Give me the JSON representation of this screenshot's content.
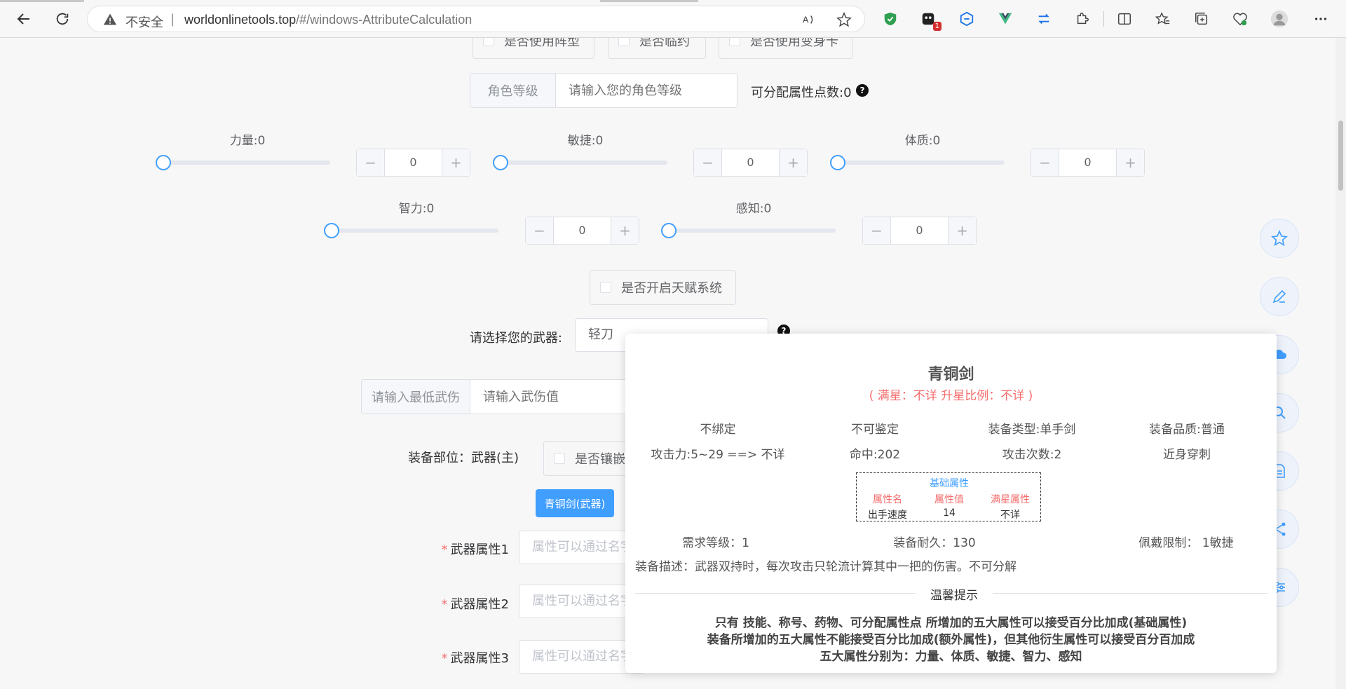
{
  "browser": {
    "insecure_label": "不安全",
    "url_host": "worldonlinetools.top",
    "url_path": "/#/windows-AttributeCalculation",
    "ext_badge": "1"
  },
  "options_top": {
    "formation": "是否使用阵型",
    "contract": "是否临约",
    "transform_card": "是否使用变身卡"
  },
  "level": {
    "label": "角色等级",
    "placeholder": "请输入您的角色等级",
    "points_text": "可分配属性点数:0"
  },
  "attributes": [
    {
      "label": "力量:0",
      "value": "0"
    },
    {
      "label": "敏捷:0",
      "value": "0"
    },
    {
      "label": "体质:0",
      "value": "0"
    },
    {
      "label": "智力:0",
      "value": "0"
    },
    {
      "label": "感知:0",
      "value": "0"
    }
  ],
  "stepper": {
    "minus": "−",
    "plus": "+"
  },
  "talent": {
    "label": "是否开启天赋系统"
  },
  "weapon": {
    "label": "请选择您的武器:",
    "selected": "轻刀"
  },
  "damage": {
    "label": "请输入最低武伤",
    "placeholder": "请输入武伤值"
  },
  "equip": {
    "slot_label": "装备部位：武器(主)",
    "inlay_label": "是否镶嵌",
    "item_button": "青铜剑(武器)"
  },
  "weapon_attrs": [
    {
      "label": "武器属性1",
      "placeholder": "属性可以通过名字"
    },
    {
      "label": "武器属性2",
      "placeholder": "属性可以通过名字"
    },
    {
      "label": "武器属性3",
      "placeholder": "属性可以通过名字"
    }
  ],
  "tooltip": {
    "title": "青铜剑",
    "subtitle": "( 满星：不详    升星比例：不详 )",
    "row1": [
      "不绑定",
      "不可鉴定",
      "装备类型:单手剑",
      "装备品质:普通"
    ],
    "row2": [
      "攻击力:5~29 ==> 不详",
      "命中:202",
      "攻击次数:2",
      "近身穿刺"
    ],
    "base_attr_title": "基础属性",
    "base_attr_headers": [
      "属性名",
      "属性值",
      "满星属性"
    ],
    "base_attr_row": [
      "出手速度",
      "14",
      "不详"
    ],
    "row3": [
      "需求等级：1",
      "装备耐久：130",
      "佩戴限制：  1敏捷"
    ],
    "description": "装备描述：武器双持时，每次攻击只轮流计算其中一把的伤害。不可分解",
    "tip_title": "温馨提示",
    "tip_lines": [
      "只有    技能、称号、药物、可分配属性点    所增加的五大属性可以接受百分比加成(基础属性)",
      "装备所增加的五大属性不能接受百分比加成(额外属性)，但其他衍生属性可以接受百分百加成",
      "五大属性分别为：力量、体质、敏捷、智力、感知"
    ]
  },
  "colors": {
    "primary": "#409eff",
    "danger": "#f56c6c"
  }
}
